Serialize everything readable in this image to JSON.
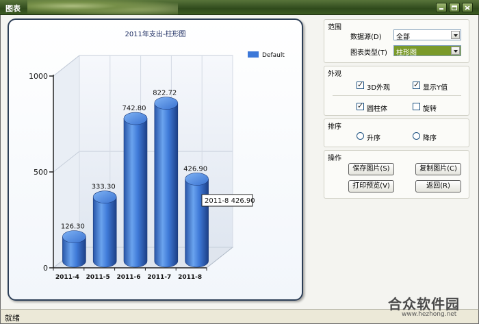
{
  "window": {
    "title": "图表"
  },
  "chart_data": {
    "type": "bar",
    "title": "2011年支出-柱形图",
    "categories": [
      "2011-4",
      "2011-5",
      "2011-6",
      "2011-7",
      "2011-8"
    ],
    "series": [
      {
        "name": "Default",
        "values": [
          126.3,
          333.3,
          742.8,
          822.72,
          426.9
        ]
      }
    ],
    "value_labels": [
      "126.30",
      "333.30",
      "742.80",
      "822.72",
      "426.90"
    ],
    "yticks": [
      "0",
      "500",
      "1000"
    ],
    "ytick_values": [
      0,
      500,
      1000
    ],
    "ylim": [
      0,
      1000
    ],
    "legend_position": "top-right",
    "tooltip": "2011-8 426.90",
    "bar_color": "#3d78d8",
    "shape": "3d-cylinder"
  },
  "range_group": {
    "title": "范围",
    "datasource_label": "数据源(D)",
    "datasource_value": "全部",
    "charttype_label": "图表类型(T)",
    "charttype_value": "柱形图"
  },
  "appearance_group": {
    "title": "外观",
    "opt_3d": "3D外观",
    "opt_showy": "显示Y值",
    "opt_cylinder": "圆柱体",
    "opt_rotate": "旋转"
  },
  "sort_group": {
    "title": "排序",
    "asc": "升序",
    "desc": "降序"
  },
  "ops_group": {
    "title": "操作",
    "save_image": "保存图片(S)",
    "copy_image": "复制图片(C)",
    "print_preview": "打印预览(V)",
    "back": "返回(R)"
  },
  "status": {
    "text": "就绪"
  },
  "watermark": {
    "name": "合众软件园",
    "url": "www.hezhong.net"
  }
}
